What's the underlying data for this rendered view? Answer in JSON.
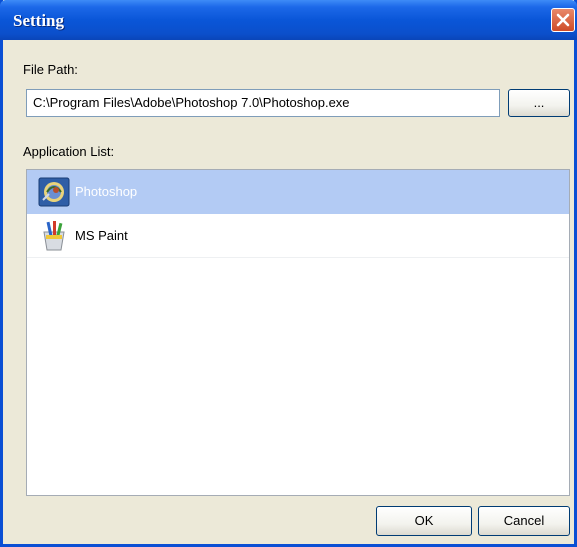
{
  "window": {
    "title": "Setting"
  },
  "file_path": {
    "label": "File Path:",
    "value": "C:\\Program Files\\Adobe\\Photoshop 7.0\\Photoshop.exe",
    "browse_label": "..."
  },
  "app_list": {
    "label": "Application List:",
    "items": [
      {
        "name": "Photoshop",
        "icon": "photoshop-icon",
        "selected": true
      },
      {
        "name": "MS Paint",
        "icon": "ms-paint-icon",
        "selected": false
      }
    ]
  },
  "buttons": {
    "ok": "OK",
    "cancel": "Cancel"
  },
  "colors": {
    "titlebar": "#0a56d8",
    "selection": "#b3cbf4",
    "dialog_bg": "#ece9d8"
  }
}
